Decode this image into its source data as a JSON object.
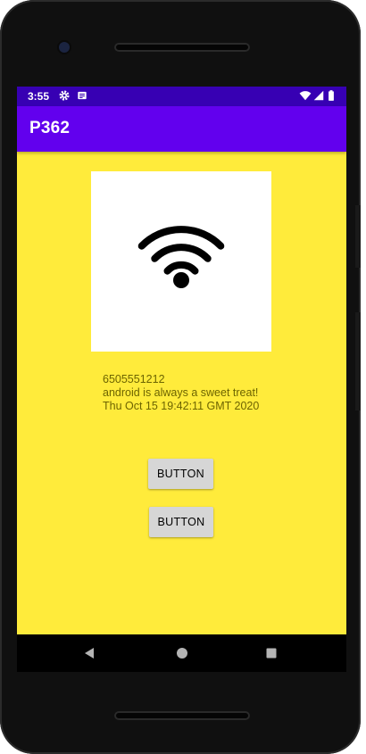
{
  "status_bar": {
    "time": "3:55",
    "left_icons": [
      "gear-icon",
      "notification-icon"
    ],
    "right_icons": [
      "wifi-icon",
      "signal-icon",
      "battery-icon"
    ]
  },
  "app_bar": {
    "title": "P362"
  },
  "main": {
    "image_icon": "wifi-icon",
    "info_lines": [
      "6505551212",
      "android is always a sweet treat!",
      "Thu Oct 15 19:42:11 GMT 2020"
    ],
    "buttons": [
      {
        "label": "BUTTON"
      },
      {
        "label": "BUTTON"
      }
    ]
  },
  "nav_bar": {
    "icons": [
      "back-icon",
      "home-icon",
      "recents-icon"
    ]
  },
  "colors": {
    "status_bar": "#3700b3",
    "app_bar": "#6200ee",
    "background": "#ffeb3b",
    "info_text": "#6d6400",
    "button": "#d6d6d6"
  }
}
